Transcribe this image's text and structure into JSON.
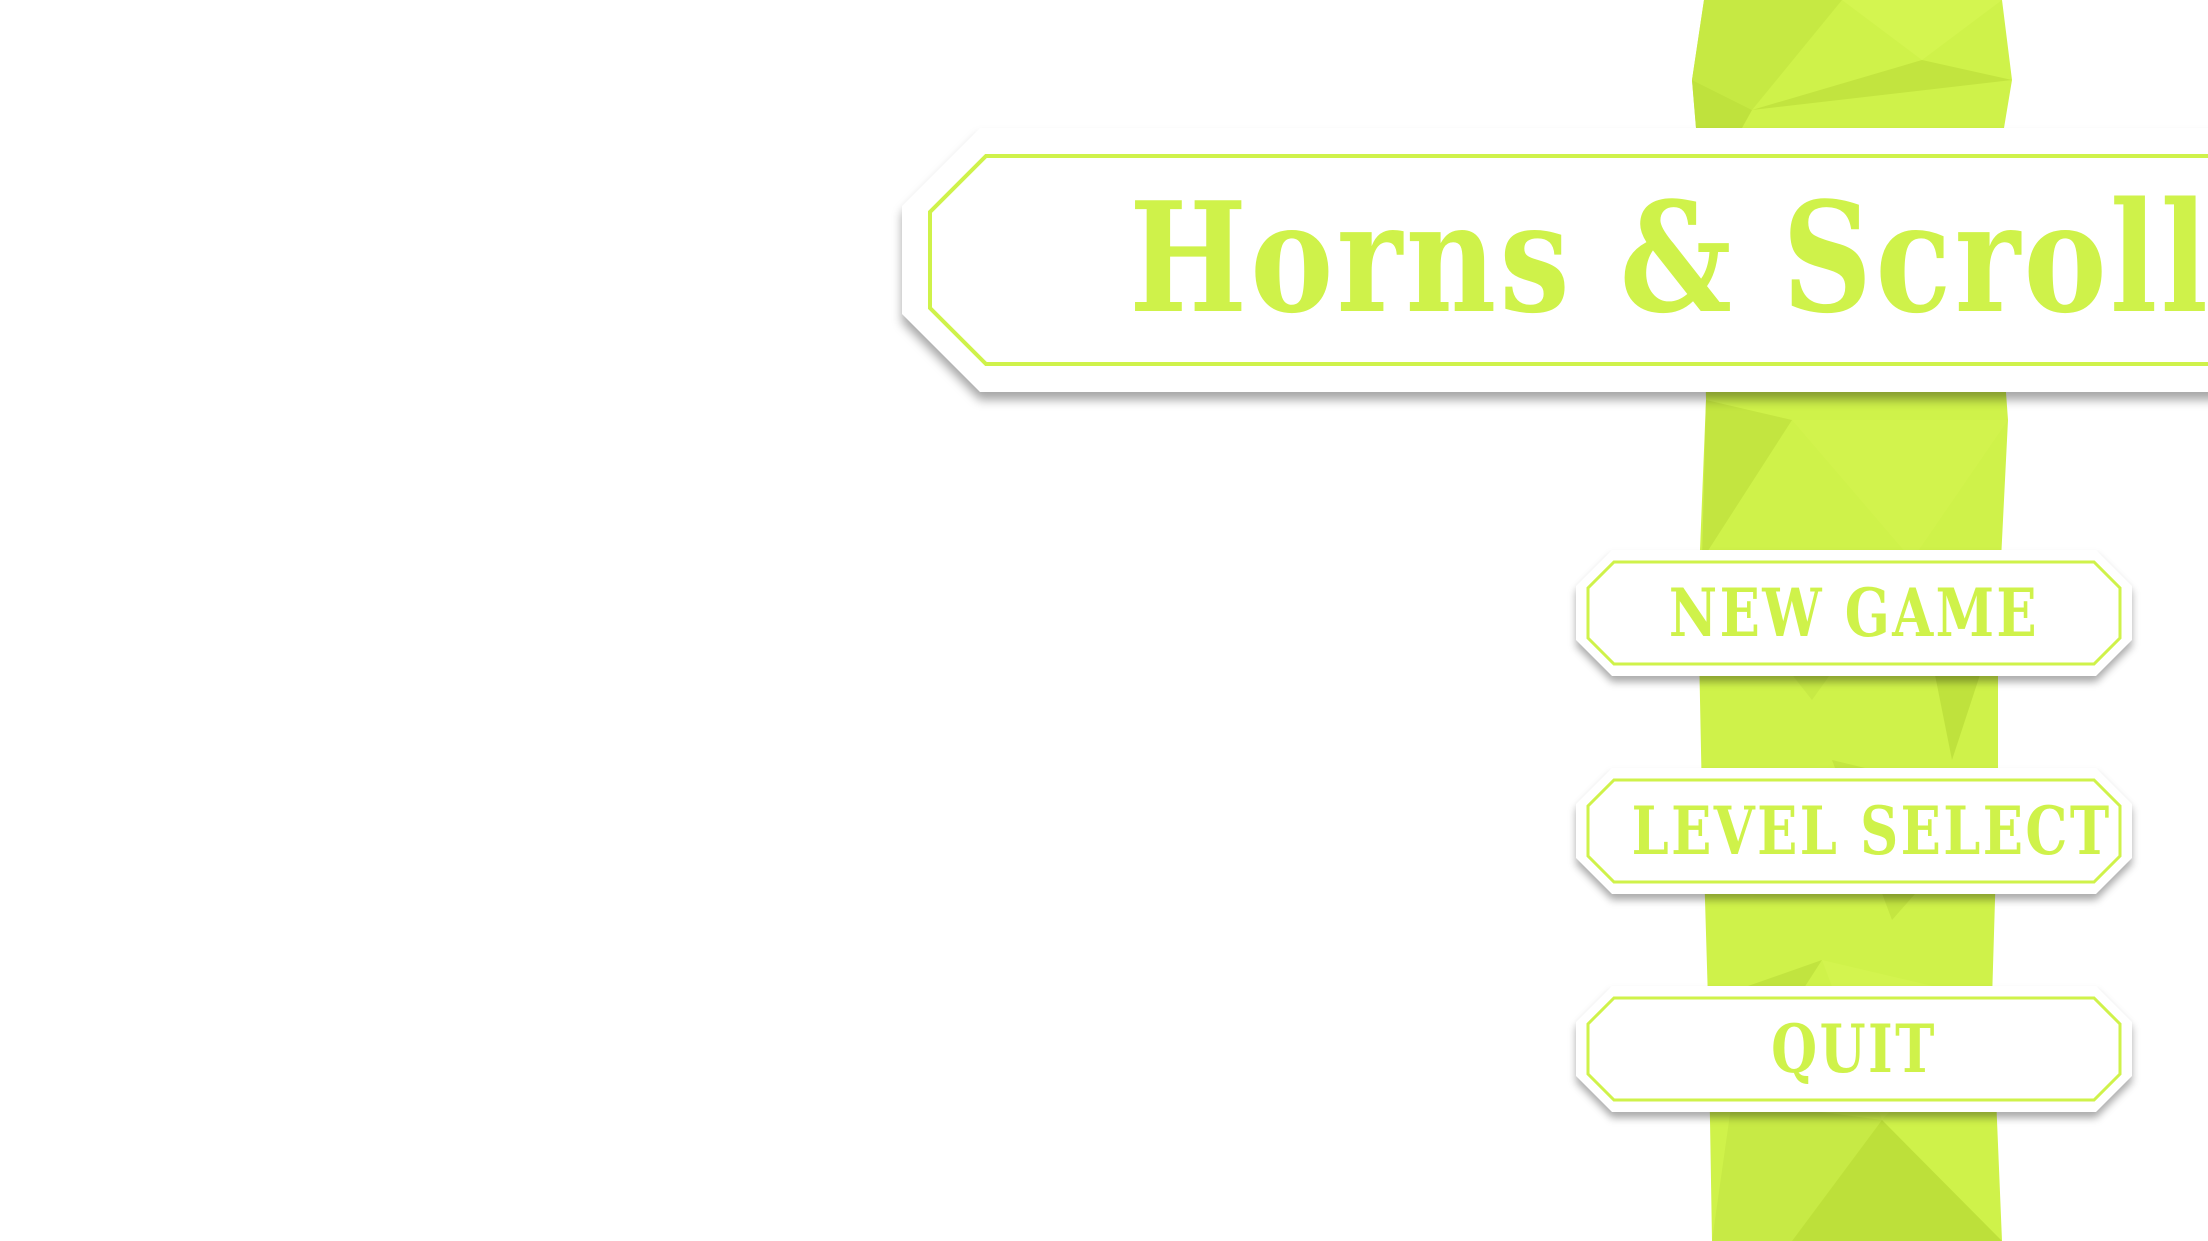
{
  "game": {
    "title": "Horns & Scrolls"
  },
  "menu": {
    "items": [
      {
        "label": "NEW GAME"
      },
      {
        "label": "LEVEL SELECT"
      },
      {
        "label": "QUIT"
      }
    ]
  },
  "colors": {
    "accent": "#cff24a",
    "accent_dark": "#bde03a",
    "panel": "#ffffff",
    "background": "#ffffff"
  }
}
